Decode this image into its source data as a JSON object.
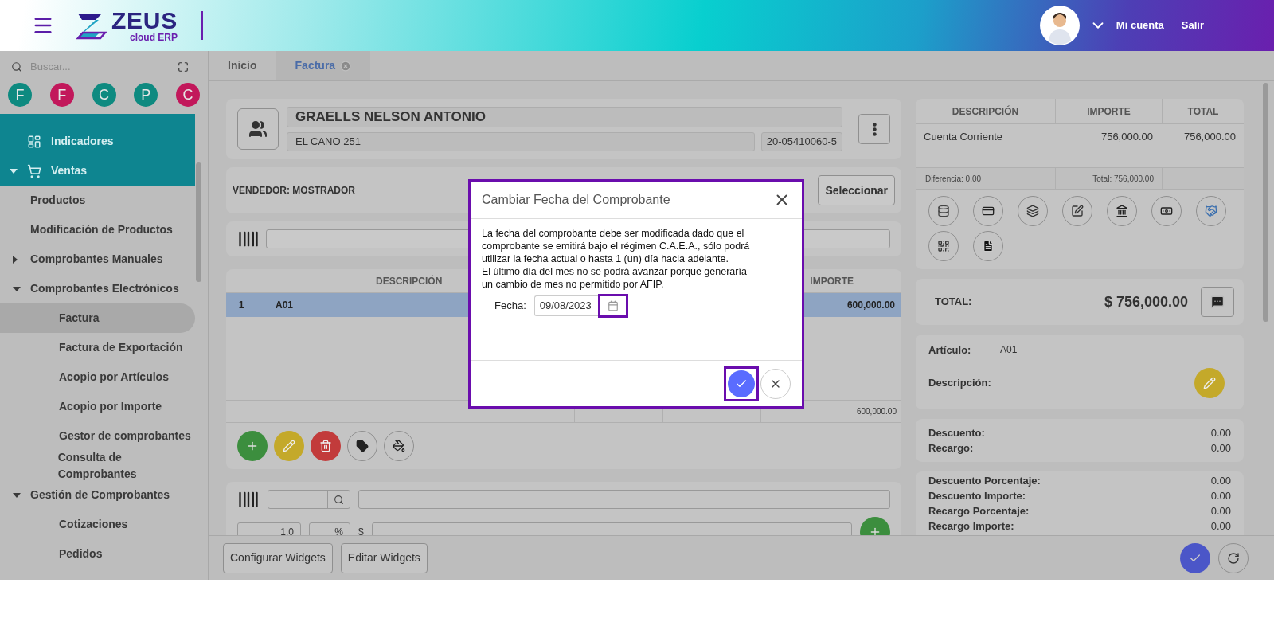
{
  "header": {
    "logo_main": "ZEUS",
    "logo_sub": "cloud ERP",
    "account": "Mi cuenta",
    "logout": "Salir"
  },
  "sidebar": {
    "search": {
      "placeholder": "Buscar..."
    },
    "shortcuts": [
      {
        "letter": "F",
        "color": "#0e8a80"
      },
      {
        "letter": "F",
        "color": "#c2185b"
      },
      {
        "letter": "C",
        "color": "#0e8a80"
      },
      {
        "letter": "P",
        "color": "#0e8a80"
      },
      {
        "letter": "C",
        "color": "#c2185b"
      }
    ],
    "items": [
      {
        "label": "Indicadores",
        "selected": false
      },
      {
        "label": "Ventas",
        "expanded": true,
        "selected": false,
        "children": [
          {
            "label": "Productos",
            "selected": false
          },
          {
            "label": "Modificación de Productos",
            "selected": false
          },
          {
            "label": "Comprobantes Manuales",
            "expanded": false,
            "selected": false
          },
          {
            "label": "Comprobantes Electrónicos",
            "expanded": true,
            "selected": false,
            "children": [
              {
                "label": "Factura",
                "selected": true
              },
              {
                "label": "Factura de Exportación",
                "selected": false
              },
              {
                "label": "Acopio por Artículos",
                "selected": false
              },
              {
                "label": "Acopio por Importe",
                "selected": false
              },
              {
                "label": "Gestor de comprobantes",
                "selected": false
              },
              {
                "label": "Consulta de Comprobantes",
                "selected": false
              }
            ]
          },
          {
            "label": "Gestión de Comprobantes",
            "expanded": true,
            "selected": false,
            "children": [
              {
                "label": "Cotizaciones",
                "selected": false
              },
              {
                "label": "Pedidos",
                "selected": false
              }
            ]
          }
        ]
      }
    ]
  },
  "tabs": [
    {
      "label": "Inicio",
      "selected": false,
      "closable": false
    },
    {
      "label": "Factura",
      "selected": true,
      "closable": true
    }
  ],
  "customer": {
    "name": "GRAELLS NELSON ANTONIO",
    "address": "EL CANO 251",
    "tax_id": "20-05410060-5"
  },
  "vendor": {
    "label": "VENDEDOR: MOSTRADOR",
    "button": "Seleccionar"
  },
  "items_table": {
    "columns": [
      "DESCRIPCIÓN",
      "IMPORTE"
    ],
    "rows": [
      {
        "number": "1",
        "description": "A01",
        "amount": "600,000.00",
        "selected": true
      }
    ],
    "footer_total": "600,000.00"
  },
  "entry_form": {
    "quantity": "1.0",
    "percent": "%",
    "currency": "$"
  },
  "payments": {
    "columns": [
      "DESCRIPCIÓN",
      "IMPORTE",
      "TOTAL"
    ],
    "rows": [
      {
        "description": "Cuenta Corriente",
        "amount": "756,000.00",
        "total": "756,000.00"
      }
    ],
    "difference": "Diferencia: 0.00",
    "sum": "Total: 756,000.00"
  },
  "total": {
    "label": "TOTAL:",
    "value": "$ 756,000.00"
  },
  "article": {
    "label": "Artículo:",
    "value": "A01",
    "description_label": "Descripción:"
  },
  "adjustments": [
    {
      "label": "Descuento:",
      "value": "0.00"
    },
    {
      "label": "Recargo:",
      "value": "0.00"
    }
  ],
  "percentages": [
    {
      "label": "Descuento Porcentaje:",
      "value": "0.00"
    },
    {
      "label": "Descuento Importe:",
      "value": "0.00"
    },
    {
      "label": "Recargo Porcentaje:",
      "value": "0.00"
    },
    {
      "label": "Recargo Importe:",
      "value": "0.00"
    }
  ],
  "bottom_bar": {
    "buttons": [
      "Configurar Widgets",
      "Editar Widgets"
    ]
  },
  "dialog": {
    "title": "Cambiar Fecha del Comprobante",
    "paragraphs": [
      "La fecha del comprobante debe ser modificada dado que el comprobante se emitirá bajo el régimen C.A.E.A., sólo podrá utilizar la fecha actual o hasta 1 (un) día hacia adelante.",
      "El último día del mes no se podrá avanzar porque generaría un cambio de mes no permitido por AFIP."
    ],
    "date_label": "Fecha:",
    "date_value": "09/08/2023"
  }
}
